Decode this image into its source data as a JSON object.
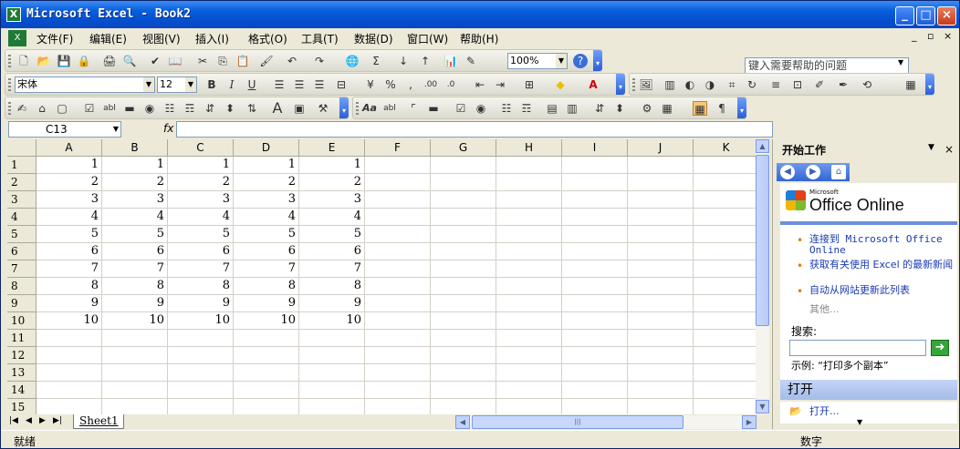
{
  "window": {
    "title": "Microsoft Excel - Book2",
    "app_icon": "X"
  },
  "menu": [
    "文件(F)",
    "编辑(E)",
    "视图(V)",
    "插入(I)",
    "格式(O)",
    "工具(T)",
    "数据(D)",
    "窗口(W)",
    "帮助(H)"
  ],
  "help_box": {
    "placeholder": "键入需要帮助的问题"
  },
  "toolbar": {
    "zoom": "100%",
    "font": "宋体",
    "font_size": "12"
  },
  "formula_bar": {
    "name_box": "C13",
    "fx": "fx",
    "value": ""
  },
  "columns": [
    "A",
    "B",
    "C",
    "D",
    "E",
    "F",
    "G",
    "H",
    "I",
    "J",
    "K"
  ],
  "rows": [
    "1",
    "2",
    "3",
    "4",
    "5",
    "6",
    "7",
    "8",
    "9",
    "10",
    "11",
    "12",
    "13",
    "14",
    "15"
  ],
  "cells": [
    [
      "1",
      "1",
      "1",
      "1",
      "1"
    ],
    [
      "2",
      "2",
      "2",
      "2",
      "2"
    ],
    [
      "3",
      "3",
      "3",
      "3",
      "3"
    ],
    [
      "4",
      "4",
      "4",
      "4",
      "4"
    ],
    [
      "5",
      "5",
      "5",
      "5",
      "5"
    ],
    [
      "6",
      "6",
      "6",
      "6",
      "6"
    ],
    [
      "7",
      "7",
      "7",
      "7",
      "7"
    ],
    [
      "8",
      "8",
      "8",
      "8",
      "8"
    ],
    [
      "9",
      "9",
      "9",
      "9",
      "9"
    ],
    [
      "10",
      "10",
      "10",
      "10",
      "10"
    ]
  ],
  "sheet_tabs": [
    "Sheet1"
  ],
  "status": {
    "left": "就绪",
    "right": "数字"
  },
  "task_pane": {
    "title": "开始工作",
    "brand_small": "Microsoft",
    "brand": "Office Online",
    "links": [
      "连接到 Microsoft Office Online",
      "获取有关使用 Excel 的最新新闻",
      "自动从网站更新此列表"
    ],
    "more": "其他...",
    "search_label": "搜索:",
    "example": "示例:   “打印多个副本”",
    "open_header": "打开",
    "open_item": "打开..."
  }
}
